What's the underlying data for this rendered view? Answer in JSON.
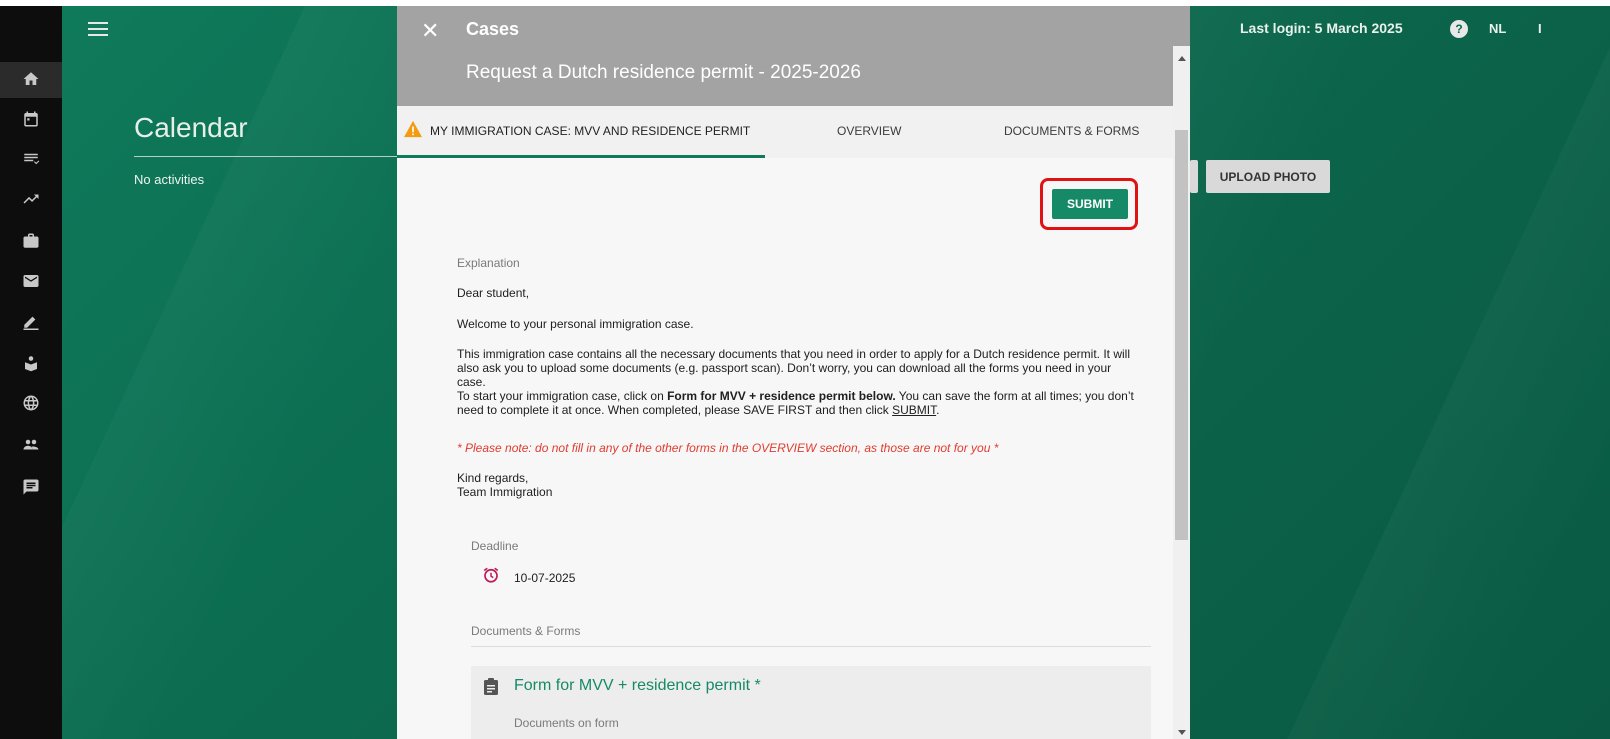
{
  "header": {
    "last_login": "Last login: 5 March 2025",
    "help_glyph": "?",
    "language": "NL",
    "user_initial": "I"
  },
  "background": {
    "calendar_title": "Calendar",
    "no_activities": "No activities",
    "upload_photo_label": "UPLOAD PHOTO"
  },
  "sidebar": {
    "icons": [
      "home-icon",
      "calendar-icon",
      "checklist-icon",
      "trending-icon",
      "briefcase-icon",
      "mail-icon",
      "edit-icon",
      "student-icon",
      "globe-icon",
      "people-icon",
      "chat-icon"
    ]
  },
  "panel": {
    "close_glyph": "✕",
    "title": "Cases",
    "subtitle": "Request a Dutch residence permit - 2025-2026",
    "tabs": [
      {
        "label": "MY IMMIGRATION CASE: MVV AND RESIDENCE PERMIT",
        "active": true
      },
      {
        "label": "OVERVIEW",
        "active": false
      },
      {
        "label": "DOCUMENTS & FORMS",
        "active": false
      }
    ],
    "submit_label": "SUBMIT",
    "explanation_label": "Explanation",
    "greeting": "Dear student,",
    "welcome": "Welcome to your personal immigration case.",
    "para1": "This immigration case contains all the necessary documents that you need in order to apply for a Dutch residence permit. It will also ask you to upload some documents (e.g. passport scan). Don’t worry, you can download all the forms you need in your case.",
    "para2_start": "To start your immigration case, click on ",
    "para2_bold": "Form for MVV + residence permit below.",
    "para2_mid": " You can save the form at all times; you don’t need to complete it at once. When completed, please SAVE FIRST and then click ",
    "para2_link": "SUBMIT",
    "para2_end": ".",
    "note": "* Please note: do not fill in any of the other forms in the OVERVIEW section, as those are not for you *",
    "regards": "Kind regards,",
    "team": "Team Immigration",
    "deadline_label": "Deadline",
    "deadline_date": "10-07-2025",
    "docs_forms_label": "Documents & Forms",
    "form_title": "Form for MVV + residence permit *",
    "form_sub": "Documents on form"
  },
  "colors": {
    "brand_green": "#0f7a5a",
    "button_green": "#168a67",
    "highlight_red": "#e01313",
    "note_red": "#e03c2f",
    "warning_orange": "#f39c12",
    "clock_pink": "#c2185b"
  }
}
